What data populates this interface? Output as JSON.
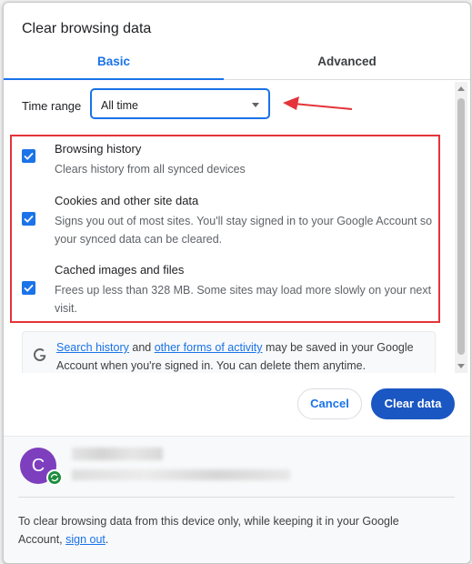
{
  "dialog": {
    "title": "Clear browsing data"
  },
  "tabs": [
    {
      "label": "Basic"
    },
    {
      "label": "Advanced"
    }
  ],
  "time_range": {
    "label": "Time range",
    "value": "All time"
  },
  "items": [
    {
      "title": "Browsing history",
      "desc": "Clears history from all synced devices",
      "checked": true
    },
    {
      "title": "Cookies and other site data",
      "desc": "Signs you out of most sites. You'll stay signed in to your Google Account so your synced data can be cleared.",
      "checked": true
    },
    {
      "title": "Cached images and files",
      "desc": "Frees up less than 328 MB. Some sites may load more slowly on your next visit.",
      "checked": true
    }
  ],
  "google_note": {
    "link1": "Search history",
    "and": " and ",
    "link2": "other forms of activity",
    "rest": " may be saved in your Google Account when you're signed in. You can delete them anytime."
  },
  "buttons": {
    "cancel": "Cancel",
    "clear": "Clear data"
  },
  "account": {
    "initial": "C"
  },
  "footer": {
    "text": "To clear browsing data from this device only, while keeping it in your Google Account, ",
    "link": "sign out",
    "end": "."
  },
  "colors": {
    "accent": "#1a73e8",
    "annotation": "#e5343a",
    "primary_button": "#1a57c2"
  }
}
